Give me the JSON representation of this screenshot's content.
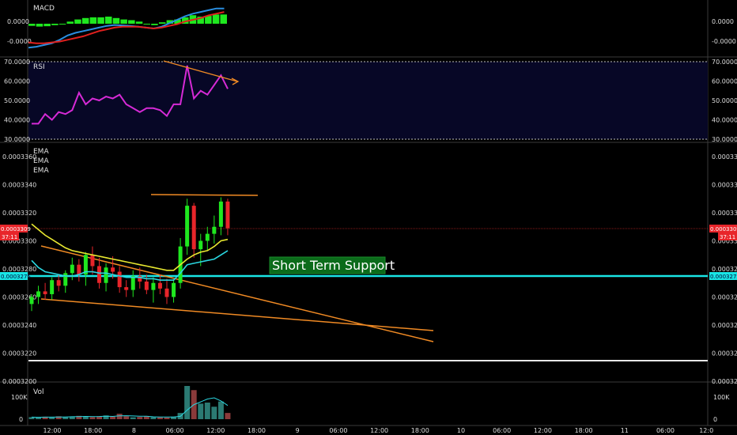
{
  "panels": {
    "macd": {
      "title": "MACD",
      "axis_labels": [
        "0.0000",
        "-0.0000"
      ],
      "right_axis_labels": [
        "0.0000",
        "-0.0000"
      ]
    },
    "rsi": {
      "title": "RSI",
      "axis_labels": [
        "70.0000",
        "60.0000",
        "50.0000",
        "40.0000",
        "30.0000"
      ]
    },
    "price": {
      "titles": [
        "EMA",
        "EMA",
        "EMA"
      ],
      "axis_labels": [
        "0.0003360",
        "0.0003340",
        "0.0003320",
        "0.0003300",
        "0.0003280",
        "0.0003260",
        "0.0003240",
        "0.0003220",
        "0.0003200"
      ],
      "current_price_tag": "0.0003309",
      "countdown_tag": "37:11",
      "support_tag": "0.0003275",
      "annotation": "Short Term Support"
    },
    "volume": {
      "title": "Vol",
      "axis_labels": [
        "100K",
        "0"
      ]
    }
  },
  "time_axis": [
    "12:00",
    "18:00",
    "8",
    "06:00",
    "12:00",
    "18:00",
    "9",
    "06:00",
    "12:00",
    "18:00",
    "10",
    "06:00",
    "12:00",
    "18:00",
    "11",
    "06:00",
    "12:0"
  ],
  "colors": {
    "up": "#1fe81f",
    "down": "#e8252a",
    "ema_fast": "#e8e830",
    "ema_slow": "#2ad6e0",
    "trendline": "#f08a24",
    "rsi": "#d62ad6",
    "macd_line": "#2a8ee0",
    "signal_line": "#e0201e",
    "support_line": "#19e6e6"
  },
  "chart_data": [
    {
      "type": "bar",
      "title": "MACD",
      "histogram": [
        -0.3,
        -0.4,
        -0.35,
        -0.2,
        -0.1,
        0.3,
        0.6,
        0.8,
        0.9,
        0.9,
        1.0,
        0.8,
        0.6,
        0.5,
        0.3,
        -0.1,
        -0.2,
        0.2,
        0.5,
        0.6,
        0.9,
        1.2,
        1.0,
        1.1,
        1.3,
        1.3
      ],
      "macd_line": [
        -2.2,
        -2.1,
        -1.9,
        -1.7,
        -1.3,
        -0.8,
        -0.5,
        -0.3,
        -0.1,
        0.1,
        0.3,
        0.4,
        0.35,
        0.3,
        0.2,
        0.1,
        0.0,
        0.2,
        0.6,
        1.0,
        1.4,
        1.7,
        1.9,
        2.1,
        2.3,
        2.3
      ],
      "signal_line": [
        -1.6,
        -1.7,
        -1.7,
        -1.6,
        -1.5,
        -1.3,
        -1.1,
        -0.9,
        -0.6,
        -0.3,
        -0.1,
        0.1,
        0.2,
        0.2,
        0.2,
        0.1,
        0.0,
        0.1,
        0.3,
        0.5,
        0.8,
        1.0,
        1.2,
        1.5,
        1.7,
        1.9
      ]
    },
    {
      "type": "line",
      "title": "RSI",
      "ylim": [
        30,
        70
      ],
      "values": [
        38,
        38,
        43,
        40,
        44,
        43,
        45,
        54,
        48,
        51,
        50,
        52,
        51,
        53,
        48,
        46,
        44,
        46,
        46,
        45,
        42,
        48,
        48,
        68,
        51,
        55,
        53,
        58,
        63,
        56
      ]
    },
    {
      "type": "candlestick",
      "ylim": [
        0.00032,
        0.000336
      ],
      "candles": [
        [
          0.0003255,
          0.0003262,
          0.000325,
          0.000326
        ],
        [
          0.000326,
          0.0003268,
          0.0003255,
          0.0003264
        ],
        [
          0.0003264,
          0.000327,
          0.0003258,
          0.0003262
        ],
        [
          0.0003262,
          0.0003274,
          0.0003258,
          0.0003272
        ],
        [
          0.0003272,
          0.0003276,
          0.0003264,
          0.0003268
        ],
        [
          0.0003268,
          0.0003279,
          0.0003263,
          0.0003277
        ],
        [
          0.0003277,
          0.0003288,
          0.0003272,
          0.0003283
        ],
        [
          0.0003283,
          0.0003287,
          0.0003271,
          0.0003276
        ],
        [
          0.0003276,
          0.0003292,
          0.0003268,
          0.000329
        ],
        [
          0.000329,
          0.0003296,
          0.0003276,
          0.0003282
        ],
        [
          0.0003282,
          0.0003288,
          0.0003266,
          0.000327
        ],
        [
          0.000327,
          0.0003284,
          0.0003264,
          0.0003281
        ],
        [
          0.0003281,
          0.0003289,
          0.0003273,
          0.0003278
        ],
        [
          0.0003278,
          0.0003282,
          0.0003263,
          0.0003267
        ],
        [
          0.0003267,
          0.0003272,
          0.000326,
          0.0003265
        ],
        [
          0.0003265,
          0.0003279,
          0.000326,
          0.0003275
        ],
        [
          0.0003275,
          0.0003281,
          0.0003266,
          0.0003271
        ],
        [
          0.0003271,
          0.0003276,
          0.0003262,
          0.0003265
        ],
        [
          0.0003265,
          0.0003274,
          0.0003256,
          0.000327
        ],
        [
          0.000327,
          0.0003276,
          0.0003262,
          0.0003266
        ],
        [
          0.0003266,
          0.0003273,
          0.0003255,
          0.000326
        ],
        [
          0.000326,
          0.0003272,
          0.0003256,
          0.000327
        ],
        [
          0.000327,
          0.0003302,
          0.0003266,
          0.0003296
        ],
        [
          0.0003296,
          0.000333,
          0.000329,
          0.0003325
        ],
        [
          0.0003325,
          0.0003327,
          0.0003288,
          0.0003294
        ],
        [
          0.0003294,
          0.0003305,
          0.0003282,
          0.00033
        ],
        [
          0.00033,
          0.000331,
          0.0003293,
          0.0003305
        ],
        [
          0.0003305,
          0.0003318,
          0.0003298,
          0.000331
        ],
        [
          0.000331,
          0.0003331,
          0.0003304,
          0.0003328
        ],
        [
          0.0003328,
          0.000333,
          0.0003304,
          0.0003309
        ]
      ],
      "ema_fast": [
        0.0003312,
        0.0003308,
        0.0003304,
        0.0003301,
        0.0003298,
        0.0003295,
        0.0003293,
        0.0003292,
        0.0003291,
        0.000329,
        0.0003289,
        0.0003288,
        0.0003287,
        0.0003286,
        0.0003285,
        0.0003284,
        0.0003283,
        0.0003282,
        0.0003281,
        0.000328,
        0.0003279,
        0.0003279,
        0.0003283,
        0.0003287,
        0.000329,
        0.0003292,
        0.0003293,
        0.0003296,
        0.00033,
        0.0003301
      ],
      "ema_slow": [
        0.0003286,
        0.0003281,
        0.0003278,
        0.0003277,
        0.0003276,
        0.0003275,
        0.0003275,
        0.0003276,
        0.0003278,
        0.0003278,
        0.0003277,
        0.0003277,
        0.0003276,
        0.0003275,
        0.0003274,
        0.0003274,
        0.0003274,
        0.0003273,
        0.0003273,
        0.0003272,
        0.0003272,
        0.0003272,
        0.0003277,
        0.0003283,
        0.0003284,
        0.0003285,
        0.0003286,
        0.0003287,
        0.000329,
        0.0003293
      ]
    },
    {
      "type": "bar",
      "title": "Vol",
      "volume": [
        10,
        8,
        12,
        9,
        14,
        11,
        13,
        16,
        12,
        10,
        14,
        18,
        12,
        26,
        14,
        9,
        11,
        13,
        10,
        9,
        8,
        12,
        30,
        160,
        140,
        75,
        80,
        60,
        85,
        30
      ]
    }
  ]
}
